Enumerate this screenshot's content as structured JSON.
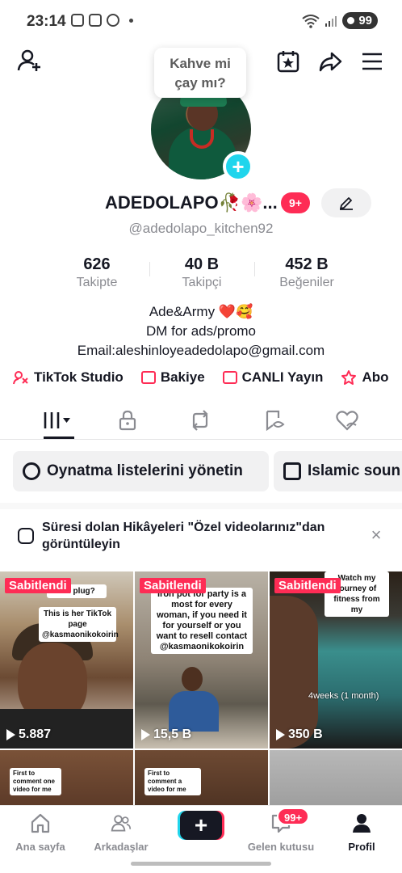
{
  "status_bar": {
    "time": "23:14",
    "battery": "99"
  },
  "tooltip": {
    "line1": "Kahve mi",
    "line2": "çay mı?"
  },
  "profile": {
    "name": "ADEDOLAPO🥀🌸...",
    "name_badge": "9+",
    "handle": "@adedolapo_kitchen92"
  },
  "stats": [
    {
      "value": "626",
      "label": "Takipte"
    },
    {
      "value": "40 B",
      "label": "Takipçi"
    },
    {
      "value": "452 B",
      "label": "Beğeniler"
    }
  ],
  "bio": {
    "line1": "Ade&Army",
    "line1_emoji": "❤️🥰",
    "line2": "DM for ads/promo",
    "line3": "Email:aleshinloyeadedolapo@gmail.com"
  },
  "quick_links": [
    {
      "label": "TikTok Studio"
    },
    {
      "label": "Bakiye"
    },
    {
      "label": "CANLI Yayın"
    },
    {
      "label": "Abo"
    }
  ],
  "playlists": {
    "manage_label": "Oynatma listelerini yönetin",
    "first_label": "Islamic soun"
  },
  "notice": {
    "text": "Süresi dolan Hikâyeleri \"Özel videolarınız\"dan görüntüleyin"
  },
  "videos": [
    {
      "pinned": "Sabitlendi",
      "views": "5.887",
      "caption": "This is her TikTok page @kasmaonikokoirin",
      "top_caption": "irin plug?"
    },
    {
      "pinned": "Sabitlendi",
      "views": "15,5 B",
      "caption": "Iron pot for party is a most for every woman, if you need it for yourself or you want to resell contact @kasmaonikokoirin"
    },
    {
      "pinned": "Sabitlendi",
      "views": "350 B",
      "caption": "Watch my journey of fitness from my",
      "overlay": "4weeks (1 month)"
    },
    {
      "caption": "First to comment one video for me"
    },
    {
      "caption": "First to comment a video for me"
    },
    {}
  ],
  "nav": {
    "home": "Ana sayfa",
    "friends": "Arkadaşlar",
    "create": "+",
    "inbox": "Gelen kutusu",
    "inbox_badge": "99+",
    "profile": "Profil"
  },
  "colors": {
    "accent": "#fe2c55",
    "cyan": "#20d5ec",
    "text": "#161823",
    "muted": "#8a8b91"
  }
}
